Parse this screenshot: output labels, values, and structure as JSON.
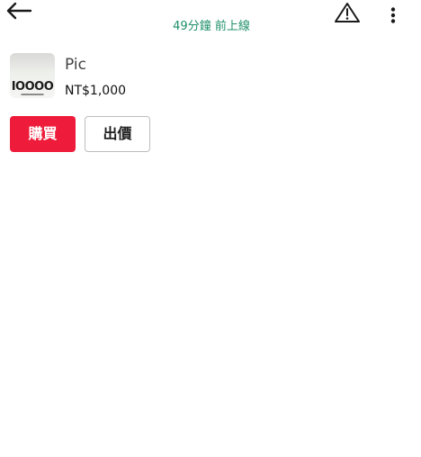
{
  "header": {
    "title_partial": "",
    "status": "49分鐘 前上線",
    "status_color": "#1f8f6a",
    "icons": {
      "back": "arrow-left-icon",
      "report": "warning-triangle-icon",
      "more": "more-vertical-icon"
    }
  },
  "listing": {
    "name": "Pic",
    "price": "NT$1,000",
    "thumbnail_text": "IOOOO"
  },
  "actions": {
    "buy_label": "購買",
    "offer_label": "出價",
    "buy_color": "#ee1c3a"
  }
}
